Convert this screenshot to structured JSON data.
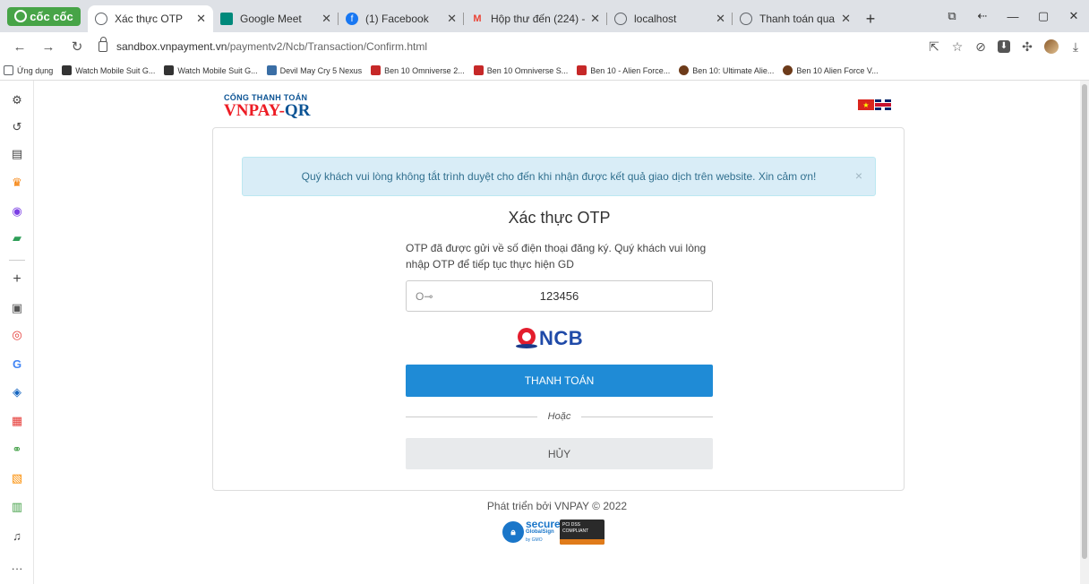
{
  "browser": {
    "brand": "cốc cốc",
    "tabs": [
      {
        "label": "Xác thực OTP",
        "active": true,
        "favicon_color": "#5f6368"
      },
      {
        "label": "Google Meet",
        "active": false,
        "favicon_color": "#00897b"
      },
      {
        "label": "(1) Facebook",
        "active": false,
        "favicon_color": "#1877f2"
      },
      {
        "label": "Hộp thư đến (224) -",
        "active": false,
        "favicon_color": "#ea4335"
      },
      {
        "label": "localhost",
        "active": false,
        "favicon_color": "#5f6368"
      },
      {
        "label": "Thanh toán qua Ng",
        "active": false,
        "favicon_color": "#5f6368"
      }
    ],
    "url_host": "sandbox.vnpayment.vn",
    "url_path": "/paymentv2/Ncb/Transaction/Confirm.html",
    "bookmarks": [
      {
        "label": "Ứng dụng",
        "color": "#5f6368"
      },
      {
        "label": "Watch Mobile Suit G...",
        "color": "#333333"
      },
      {
        "label": "Watch Mobile Suit G...",
        "color": "#333333"
      },
      {
        "label": "Devil May Cry 5 Nexus",
        "color": "#3a6ea5"
      },
      {
        "label": "Ben 10 Omniverse 2...",
        "color": "#c62828"
      },
      {
        "label": "Ben 10 Omniverse S...",
        "color": "#c62828"
      },
      {
        "label": "Ben 10 - Alien Force...",
        "color": "#c62828"
      },
      {
        "label": "Ben 10: Ultimate Alie...",
        "color": "#6d3b1a"
      },
      {
        "label": "Ben 10 Alien Force V...",
        "color": "#6d3b1a"
      }
    ]
  },
  "page": {
    "logo_small": "CỔNG THANH TOÁN",
    "logo_vnpay": "VNPAY-",
    "logo_qr": "QR",
    "alert": "Quý khách vui lòng không tắt trình duyệt cho đến khi nhận được kết quả giao dịch trên website. Xin cảm ơn!",
    "alert_close": "×",
    "title": "Xác thực OTP",
    "description": "OTP đã được gửi về số điện thoại đăng ký. Quý khách vui lòng nhập OTP để tiếp tục thực hiện GD",
    "otp_value": "123456",
    "bank_name": "NCB",
    "pay_button": "THANH TOÁN",
    "or_text": "Hoặc",
    "cancel_button": "HỦY",
    "footer": "Phát triển bởi VNPAY © 2022",
    "badge_secure_a": "secure",
    "badge_secure_b": "GlobalSign",
    "badge_secure_c": "by GMO",
    "badge_pci": "PCI DSS COMPLIANT"
  },
  "colors": {
    "primary_button": "#1f8bd6",
    "alert_bg": "#d9edf7",
    "alert_text": "#31708f",
    "logo_red": "#ed1c24",
    "logo_blue": "#0b5394"
  }
}
